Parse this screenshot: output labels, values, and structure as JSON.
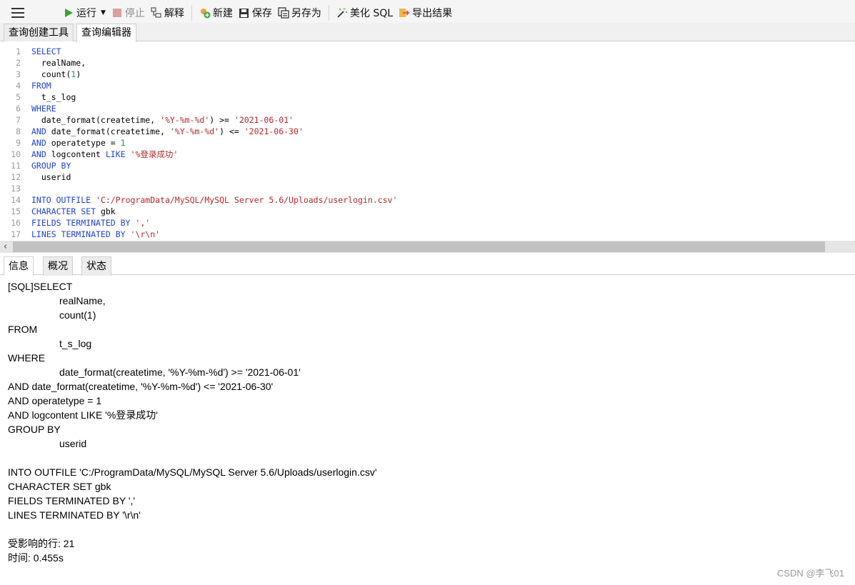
{
  "toolbar": {
    "run": "运行",
    "stop": "停止",
    "explain": "解释",
    "new": "新建",
    "save": "保存",
    "save_as": "另存为",
    "beautify": "美化 SQL",
    "export": "导出结果"
  },
  "tabs": [
    "查询创建工具",
    "查询编辑器"
  ],
  "editor_lines": [
    {
      "n": "1",
      "parts": [
        {
          "t": "SELECT",
          "c": "kw"
        }
      ]
    },
    {
      "n": "2",
      "parts": [
        {
          "t": "  realName,",
          "c": "pl"
        }
      ]
    },
    {
      "n": "3",
      "parts": [
        {
          "t": "  count(",
          "c": "pl"
        },
        {
          "t": "1",
          "c": "num"
        },
        {
          "t": ")",
          "c": "pl"
        }
      ]
    },
    {
      "n": "4",
      "parts": [
        {
          "t": "FROM",
          "c": "kw"
        }
      ]
    },
    {
      "n": "5",
      "parts": [
        {
          "t": "  t_s_log",
          "c": "pl"
        }
      ]
    },
    {
      "n": "6",
      "parts": [
        {
          "t": "WHERE",
          "c": "kw"
        }
      ]
    },
    {
      "n": "7",
      "parts": [
        {
          "t": "  date_format(createtime, ",
          "c": "pl"
        },
        {
          "t": "'%Y-%m-%d'",
          "c": "str"
        },
        {
          "t": ") >= ",
          "c": "pl"
        },
        {
          "t": "'2021-06-01'",
          "c": "str"
        }
      ]
    },
    {
      "n": "8",
      "parts": [
        {
          "t": "AND",
          "c": "kw"
        },
        {
          "t": " date_format(createtime, ",
          "c": "pl"
        },
        {
          "t": "'%Y-%m-%d'",
          "c": "str"
        },
        {
          "t": ") <= ",
          "c": "pl"
        },
        {
          "t": "'2021-06-30'",
          "c": "str"
        }
      ]
    },
    {
      "n": "9",
      "parts": [
        {
          "t": "AND",
          "c": "kw"
        },
        {
          "t": " operatetype = ",
          "c": "pl"
        },
        {
          "t": "1",
          "c": "num"
        }
      ]
    },
    {
      "n": "10",
      "parts": [
        {
          "t": "AND",
          "c": "kw"
        },
        {
          "t": " logcontent ",
          "c": "pl"
        },
        {
          "t": "LIKE",
          "c": "kw"
        },
        {
          "t": " ",
          "c": "pl"
        },
        {
          "t": "'%登录成功'",
          "c": "str"
        }
      ]
    },
    {
      "n": "11",
      "parts": [
        {
          "t": "GROUP BY",
          "c": "kw"
        }
      ]
    },
    {
      "n": "12",
      "parts": [
        {
          "t": "  userid",
          "c": "pl"
        }
      ]
    },
    {
      "n": "13",
      "parts": []
    },
    {
      "n": "14",
      "parts": [
        {
          "t": "INTO OUTFILE",
          "c": "kw"
        },
        {
          "t": " ",
          "c": "pl"
        },
        {
          "t": "'C:/ProgramData/MySQL/MySQL Server 5.6/Uploads/userlogin.csv'",
          "c": "str"
        }
      ]
    },
    {
      "n": "15",
      "parts": [
        {
          "t": "CHARACTER SET",
          "c": "kw"
        },
        {
          "t": " gbk",
          "c": "pl"
        }
      ]
    },
    {
      "n": "16",
      "parts": [
        {
          "t": "FIELDS TERMINATED BY",
          "c": "kw"
        },
        {
          "t": " ",
          "c": "pl"
        },
        {
          "t": "','",
          "c": "str"
        }
      ]
    },
    {
      "n": "17",
      "parts": [
        {
          "t": "LINES TERMINATED BY",
          "c": "kw"
        },
        {
          "t": " ",
          "c": "pl"
        },
        {
          "t": "'\\r\\n'",
          "c": "str"
        }
      ]
    }
  ],
  "bottom_tabs": [
    "信息",
    "概况",
    "状态"
  ],
  "output_lines": [
    {
      "t": "[SQL]SELECT",
      "ind": false
    },
    {
      "t": "realName,",
      "ind": true
    },
    {
      "t": "count(1)",
      "ind": true
    },
    {
      "t": "FROM",
      "ind": false
    },
    {
      "t": "t_s_log",
      "ind": true
    },
    {
      "t": "WHERE",
      "ind": false
    },
    {
      "t": "date_format(createtime, '%Y-%m-%d') >= '2021-06-01'",
      "ind": true
    },
    {
      "t": "AND date_format(createtime, '%Y-%m-%d') <= '2021-06-30'",
      "ind": false
    },
    {
      "t": "AND operatetype = 1",
      "ind": false
    },
    {
      "t": "AND logcontent LIKE '%登录成功'",
      "ind": false
    },
    {
      "t": "GROUP BY",
      "ind": false
    },
    {
      "t": "userid",
      "ind": true
    },
    {
      "t": "",
      "ind": false
    },
    {
      "t": "INTO OUTFILE 'C:/ProgramData/MySQL/MySQL Server 5.6/Uploads/userlogin.csv'",
      "ind": false
    },
    {
      "t": "CHARACTER SET gbk",
      "ind": false
    },
    {
      "t": "FIELDS TERMINATED BY ','",
      "ind": false
    },
    {
      "t": "LINES TERMINATED BY '\\r\\n'",
      "ind": false
    },
    {
      "t": "",
      "ind": false
    },
    {
      "t": "受影响的行: 21",
      "ind": false
    },
    {
      "t": "时间: 0.455s",
      "ind": false
    }
  ],
  "watermark": "CSDN @李飞01",
  "colors": {
    "keyword": "#2244cc",
    "string": "#b22a2a",
    "number": "#22964a",
    "run_icon": "#2ea82e"
  },
  "icons": [
    "menu-icon",
    "play-icon",
    "dropdown-arrow-icon",
    "stop-icon",
    "explain-icon",
    "new-icon",
    "save-icon",
    "save-as-icon",
    "magic-wand-icon",
    "export-icon"
  ]
}
